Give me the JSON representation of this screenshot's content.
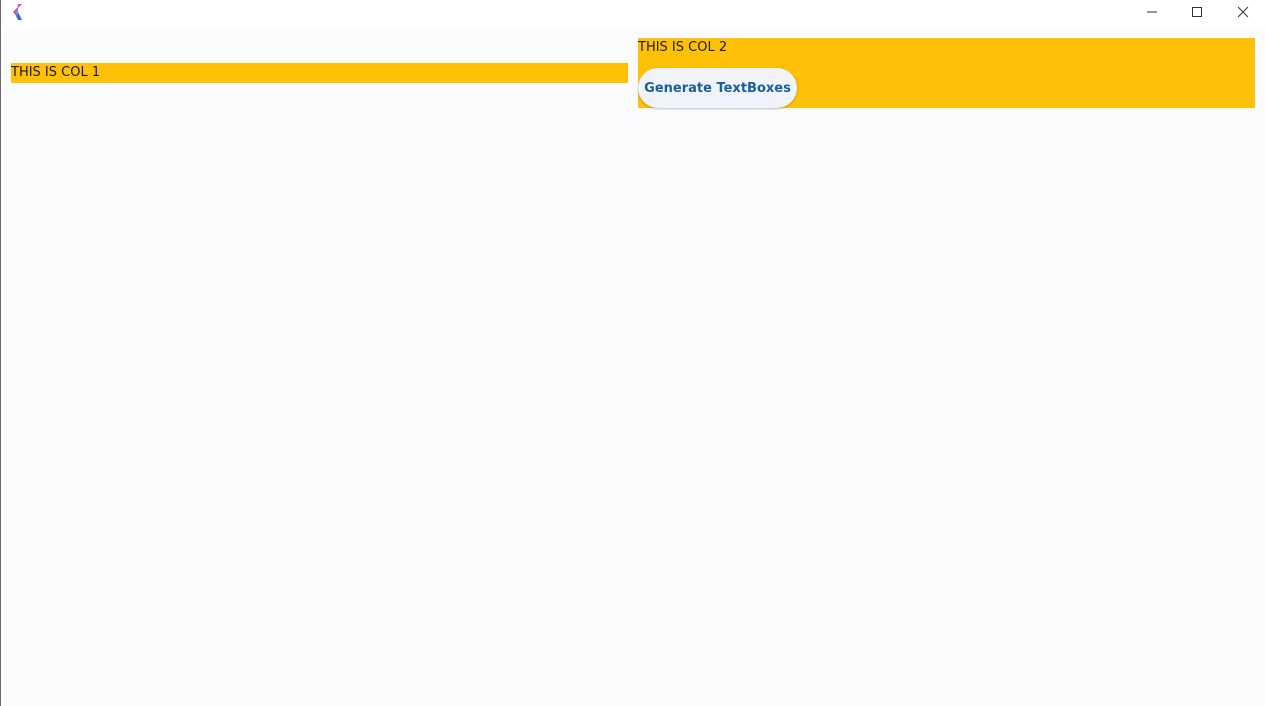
{
  "window": {
    "controls": {
      "minimize_icon": "minimize-icon",
      "maximize_icon": "maximize-icon",
      "close_icon": "close-icon"
    }
  },
  "columns": {
    "col1": {
      "label": "THIS IS COL 1"
    },
    "col2": {
      "label": "THIS IS COL 2",
      "button_label": "Generate TextBoxes"
    }
  },
  "colors": {
    "column_background": "#ffc107",
    "page_background": "#fcfcff",
    "button_text": "#1a5e97",
    "button_background": "#f0f4fa"
  }
}
